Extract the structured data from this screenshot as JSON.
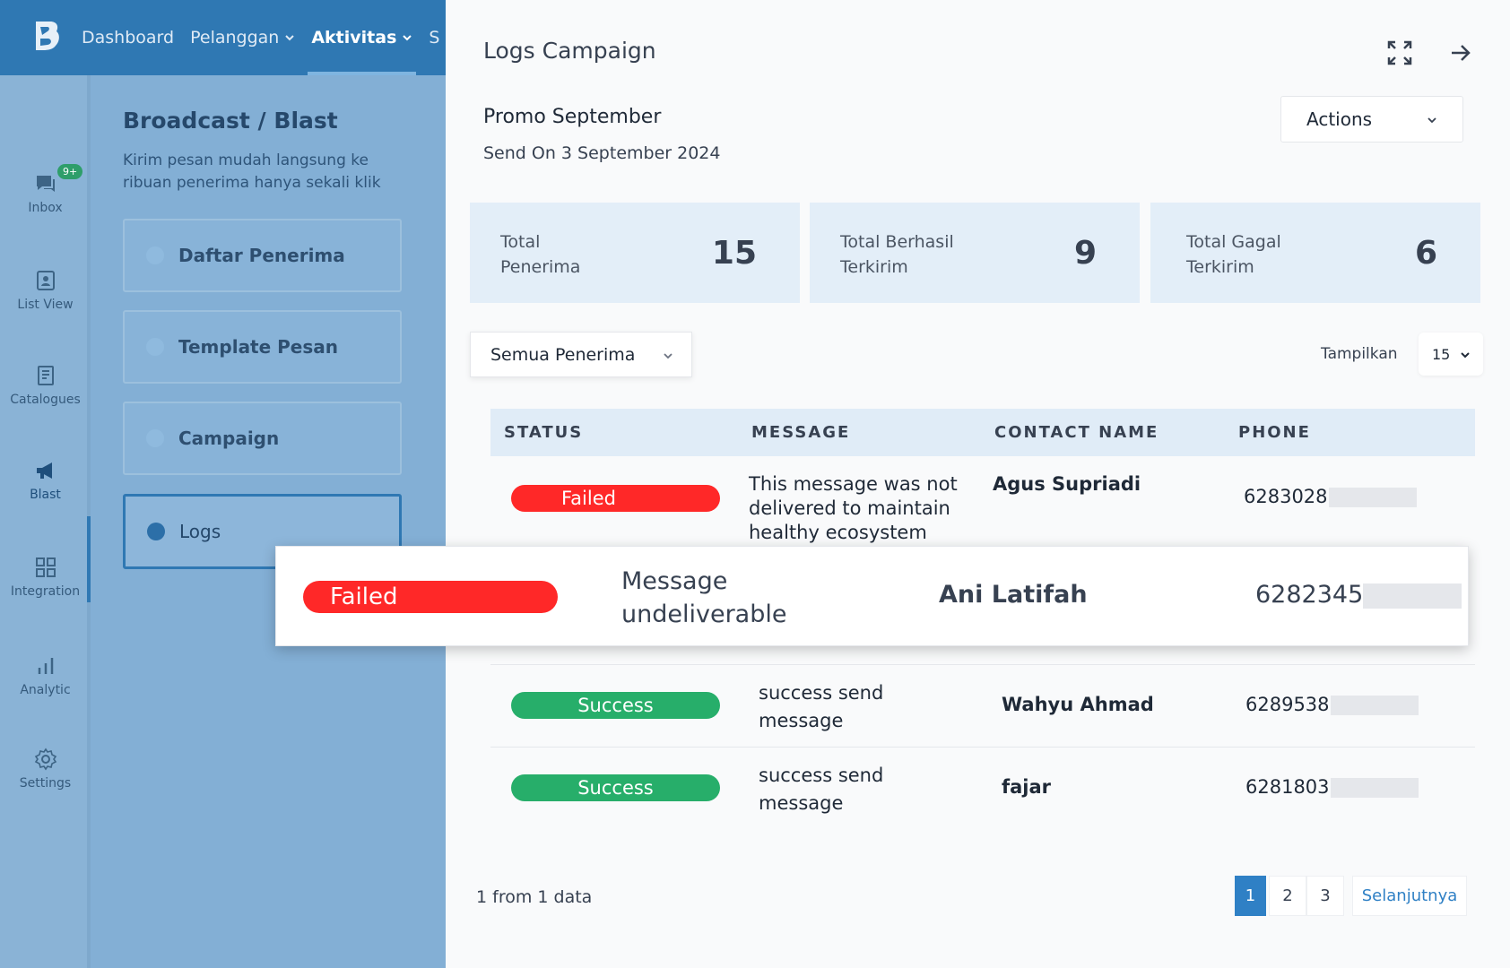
{
  "topbar": {
    "nav": [
      {
        "label": "Dashboard",
        "has_menu": false
      },
      {
        "label": "Pelanggan",
        "has_menu": true
      },
      {
        "label": "Aktivitas",
        "has_menu": true,
        "active": true
      },
      {
        "label": "S",
        "has_menu": false
      }
    ]
  },
  "rail": {
    "inbox_badge": "9+",
    "items": [
      {
        "label": "Inbox",
        "icon": "chat-icon"
      },
      {
        "label": "List View",
        "icon": "contact-card-icon"
      },
      {
        "label": "Catalogues",
        "icon": "book-icon"
      },
      {
        "label": "Blast",
        "icon": "megaphone-icon"
      },
      {
        "label": "Integration",
        "icon": "grid-icon"
      },
      {
        "label": "Analytic",
        "icon": "bar-chart-icon"
      },
      {
        "label": "Settings",
        "icon": "gear-icon"
      }
    ]
  },
  "sidepanel": {
    "title": "Broadcast / Blast",
    "description": "Kirim pesan mudah langsung ke ribuan penerima hanya sekali klik",
    "menu": [
      {
        "label": "Daftar Penerima"
      },
      {
        "label": "Template Pesan"
      },
      {
        "label": "Campaign"
      },
      {
        "label": "Logs",
        "active": true
      }
    ]
  },
  "drawer": {
    "title": "Logs Campaign",
    "campaign_name": "Promo September",
    "send_on": "Send On 3 September 2024",
    "actions_label": "Actions",
    "stats": [
      {
        "label_line1": "Total",
        "label_line2": "Penerima",
        "value": "15"
      },
      {
        "label_line1": "Total Berhasil",
        "label_line2": "Terkirim",
        "value": "9"
      },
      {
        "label_line1": "Total Gagal",
        "label_line2": "Terkirim",
        "value": "6"
      }
    ],
    "filter_value": "Semua Penerima",
    "show_label": "Tampilkan",
    "show_value": "15",
    "table": {
      "headers": [
        "STATUS",
        "MESSAGE",
        "CONTACT NAME",
        "PHONE"
      ],
      "rows": [
        {
          "status": "Failed",
          "message_lines": [
            "This message was not",
            "delivered to maintain",
            "healthy ecosystem"
          ],
          "contact": "Agus Supriadi",
          "phone": "6283028"
        },
        {
          "status": "Failed",
          "message_lines": [
            "Message",
            "undeliverable"
          ],
          "contact": "Ani Latifah",
          "phone": "6282345"
        },
        {
          "status": "Success",
          "message_lines": [
            "success send",
            "message"
          ],
          "contact": "Wahyu Ahmad",
          "phone": "6289538"
        },
        {
          "status": "Success",
          "message_lines": [
            "success send",
            "message"
          ],
          "contact": "fajar",
          "phone": "6281803"
        }
      ]
    },
    "footer_count": "1 from 1 data",
    "pages": [
      "1",
      "2",
      "3"
    ],
    "current_page": "1",
    "next_label": "Selanjutnya"
  },
  "colors": {
    "primary": "#2f78b3",
    "failed": "#ff2828",
    "success": "#27ae6a",
    "stat_bg": "#e3eef8",
    "header_bg": "#e0ecf7"
  }
}
